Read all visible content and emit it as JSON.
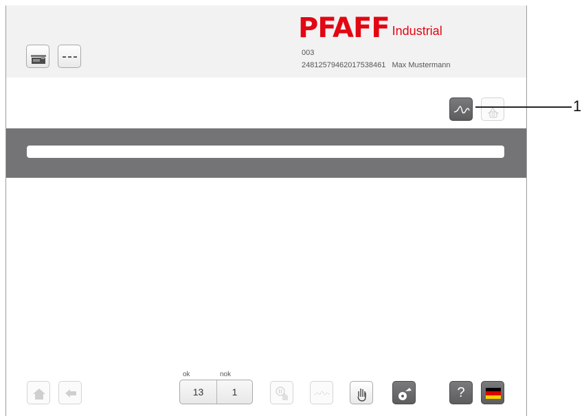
{
  "header": {
    "brand_name": "PFAFF",
    "brand_suffix": "Industrial",
    "machine_number": "003",
    "serial_and_user": "24812579462017538461   Max Mustermann",
    "brand_color": "#e30613"
  },
  "toolbar_right": {
    "icons": [
      "seam-curve-icon",
      "bobbin-weight-icon"
    ]
  },
  "footer": {
    "ok_label": "ok",
    "nok_label": "nok",
    "ok_count": "13",
    "nok_count": "1",
    "help_label": "?",
    "icons": [
      "home-icon",
      "back-arrow-icon",
      "pause-hand-icon",
      "stitch-curve-icon",
      "hand-icon",
      "bobbin-thread-icon",
      "help-icon",
      "german-flag-icon"
    ]
  },
  "callout": {
    "number": "1"
  },
  "colors": {
    "dark_band": "#747476",
    "dark_button": "#5d5d5f"
  }
}
